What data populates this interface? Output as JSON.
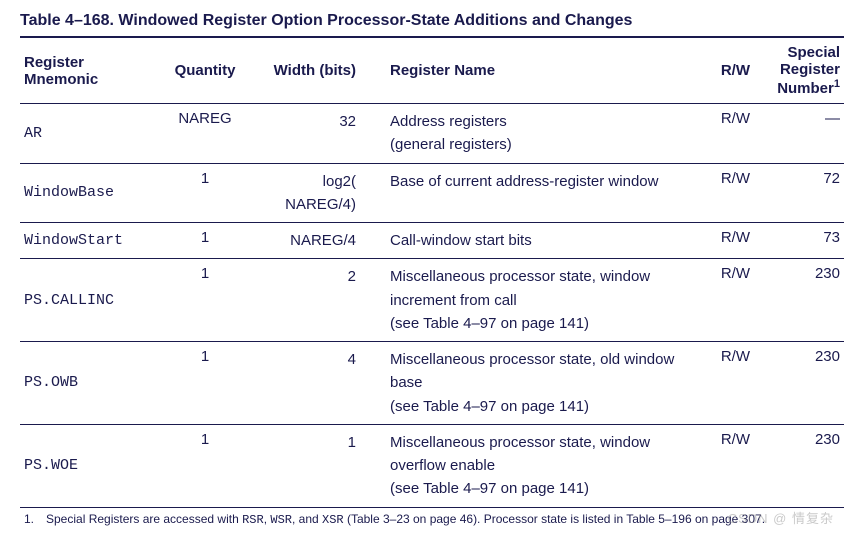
{
  "title": "Table 4–168.  Windowed Register Option Processor-State Additions and Changes",
  "headers": {
    "mnemonic": "Register Mnemonic",
    "quantity": "Quantity",
    "width": "Width (bits)",
    "name": "Register Name",
    "rw": "R/W",
    "special": "Special Register Number",
    "special_sup": "1"
  },
  "rows": [
    {
      "mnemonic": "AR",
      "quantity": "NAREG",
      "width": "32",
      "name": "Address registers\n(general registers)",
      "rw": "R/W",
      "special": "—"
    },
    {
      "mnemonic": "WindowBase",
      "quantity": "1",
      "width": "log2(\nNAREG/4)",
      "name": "Base of current address-register window",
      "rw": "R/W",
      "special": "72"
    },
    {
      "mnemonic": "WindowStart",
      "quantity": "1",
      "width": "NAREG/4",
      "name": "Call-window start bits",
      "rw": "R/W",
      "special": "73"
    },
    {
      "mnemonic": "PS.CALLINC",
      "quantity": "1",
      "width": "2",
      "name": "Miscellaneous processor state, window increment from call\n(see Table 4–97 on page 141)",
      "rw": "R/W",
      "special": "230"
    },
    {
      "mnemonic": "PS.OWB",
      "quantity": "1",
      "width": "4",
      "name": "Miscellaneous processor state, old window base\n(see Table 4–97 on page 141)",
      "rw": "R/W",
      "special": "230"
    },
    {
      "mnemonic": "PS.WOE",
      "quantity": "1",
      "width": "1",
      "name": "Miscellaneous processor state, window overflow enable\n(see Table 4–97 on page 141)",
      "rw": "R/W",
      "special": "230"
    }
  ],
  "footnote": {
    "num": "1.",
    "pre": "Special Registers are accessed with ",
    "m1": "RSR",
    "sep1": ", ",
    "m2": "WSR",
    "sep2": ", and ",
    "m3": "XSR",
    "post": " (Table 3–23 on page 46). Processor state is listed in Table 5–196 on page 307."
  },
  "watermark": "CSDN @ 情复杂"
}
